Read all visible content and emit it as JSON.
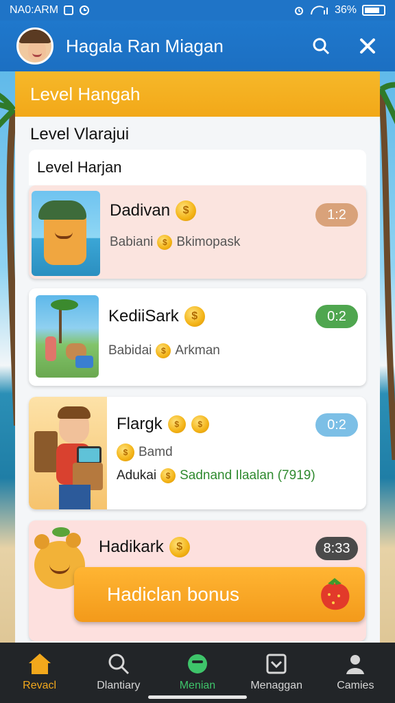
{
  "status_bar": {
    "time": "NA0:ARM",
    "battery": "36%"
  },
  "app_bar": {
    "title": "Hagala Ran Miagan"
  },
  "banner": {
    "title": "Level Hangah"
  },
  "section": {
    "title": "Level Vlarajui"
  },
  "list": {
    "header": "Level Harjan",
    "cards": [
      {
        "title": "Dadivan",
        "subtitle_a": "Babiani",
        "subtitle_b": "Bkimopask",
        "badge": "1:2",
        "badge_color": "#d9a27a",
        "bg": "#fbe4df"
      },
      {
        "title": "KediiSark",
        "subtitle_a": "Babidai",
        "subtitle_b": "Arkman",
        "badge": "0:2",
        "badge_color": "#4fa64f",
        "bg": "#ffffff"
      },
      {
        "title": "Flargk",
        "subtitle_a": "Bamd",
        "line_a": "Adukai",
        "line_b": "Sadnand Ilaalan (7919)",
        "badge": "0:2",
        "badge_color": "#7cbfe6",
        "bg": "#ffffff"
      },
      {
        "title": "Hadikark",
        "badge": "8:33",
        "badge_color": "#4a4a4a",
        "bg": "#fde0de"
      }
    ]
  },
  "bonus_button": {
    "label": "Hadiclan bonus"
  },
  "bottom_nav": {
    "items": [
      {
        "label": "Revacl",
        "icon": "home-icon"
      },
      {
        "label": "Dlantiary",
        "icon": "search-icon"
      },
      {
        "label": "Menian",
        "icon": "chat-icon"
      },
      {
        "label": "Menaggan",
        "icon": "inbox-icon"
      },
      {
        "label": "Camies",
        "icon": "person-icon"
      }
    ]
  },
  "colors": {
    "accent_blue": "#1f74c7",
    "banner_orange": "#f2a818",
    "nav_bg": "#222528",
    "active_home": "#f2a81c",
    "active_green": "#3ec46a",
    "sub_green": "#2f8a2f"
  }
}
